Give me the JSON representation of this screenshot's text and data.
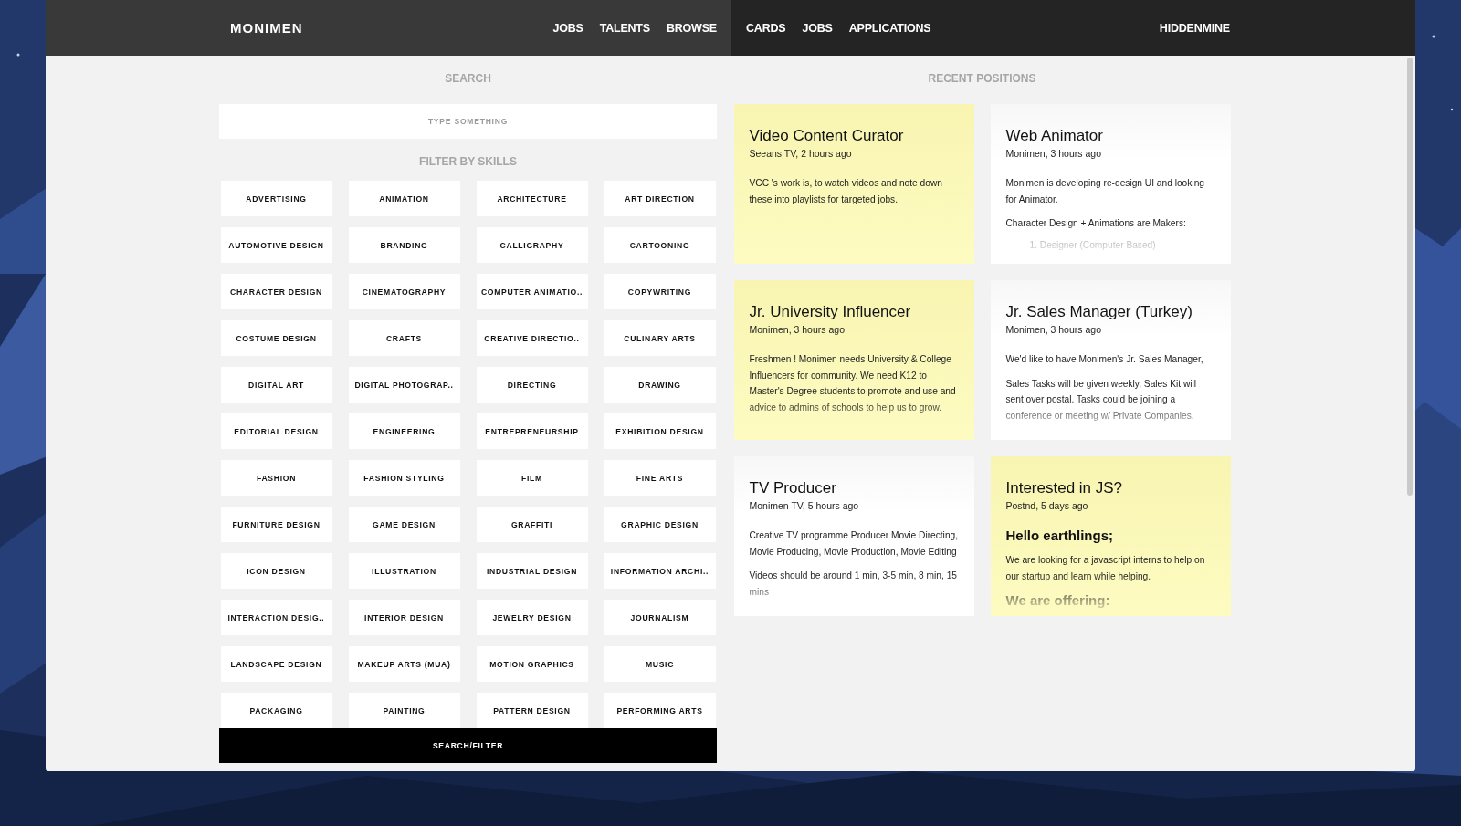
{
  "header": {
    "logo": "MONIMEN",
    "left_nav": [
      "JOBS",
      "TALENTS",
      "BROWSE"
    ],
    "right_nav": [
      "CARDS",
      "JOBS",
      "APPLICATIONS"
    ],
    "user": "HIDDENMINE"
  },
  "search": {
    "label": "SEARCH",
    "placeholder": "TYPE SOMETHING",
    "filter_label": "FILTER BY SKILLS",
    "button": "SEARCH/FILTER"
  },
  "skills": [
    {
      "label": "ADVERTISING",
      "selected": false
    },
    {
      "label": "ANIMATION",
      "selected": false
    },
    {
      "label": "ARCHITECTURE",
      "selected": false
    },
    {
      "label": "ART DIRECTION",
      "selected": false
    },
    {
      "label": "AUTOMOTIVE DESIGN",
      "selected": false
    },
    {
      "label": "BRANDING",
      "selected": false
    },
    {
      "label": "CALLIGRAPHY",
      "selected": false
    },
    {
      "label": "CARTOONING",
      "selected": false
    },
    {
      "label": "CHARACTER DESIGN",
      "selected": false
    },
    {
      "label": "CINEMATOGRAPHY",
      "selected": false
    },
    {
      "label": "COMPUTER ANIMATIO..",
      "selected": false
    },
    {
      "label": "COPYWRITING",
      "selected": false
    },
    {
      "label": "COSTUME DESIGN",
      "selected": false
    },
    {
      "label": "CRAFTS",
      "selected": false
    },
    {
      "label": "CREATIVE DIRECTIO..",
      "selected": false
    },
    {
      "label": "CULINARY ARTS",
      "selected": false
    },
    {
      "label": "DIGITAL ART",
      "selected": false
    },
    {
      "label": "DIGITAL PHOTOGRAP..",
      "selected": false
    },
    {
      "label": "DIRECTING",
      "selected": false
    },
    {
      "label": "DRAWING",
      "selected": false
    },
    {
      "label": "EDITORIAL DESIGN",
      "selected": false
    },
    {
      "label": "ENGINEERING",
      "selected": false
    },
    {
      "label": "ENTREPRENEURSHIP",
      "selected": false
    },
    {
      "label": "EXHIBITION DESIGN",
      "selected": false
    },
    {
      "label": "FASHION",
      "selected": false
    },
    {
      "label": "FASHION STYLING",
      "selected": false
    },
    {
      "label": "FILM",
      "selected": false
    },
    {
      "label": "FINE ARTS",
      "selected": false
    },
    {
      "label": "FURNITURE DESIGN",
      "selected": false
    },
    {
      "label": "GAME DESIGN",
      "selected": false
    },
    {
      "label": "GRAFFITI",
      "selected": false
    },
    {
      "label": "GRAPHIC DESIGN",
      "selected": false
    },
    {
      "label": "ICON DESIGN",
      "selected": false
    },
    {
      "label": "ILLUSTRATION",
      "selected": false
    },
    {
      "label": "INDUSTRIAL DESIGN",
      "selected": false
    },
    {
      "label": "INFORMATION ARCHI..",
      "selected": false
    },
    {
      "label": "INTERACTION DESIG..",
      "selected": false
    },
    {
      "label": "INTERIOR DESIGN",
      "selected": false
    },
    {
      "label": "JEWELRY DESIGN",
      "selected": false
    },
    {
      "label": "JOURNALISM",
      "selected": false
    },
    {
      "label": "LANDSCAPE DESIGN",
      "selected": false
    },
    {
      "label": "MAKEUP ARTS (MUA)",
      "selected": false
    },
    {
      "label": "MOTION GRAPHICS",
      "selected": false
    },
    {
      "label": "MUSIC",
      "selected": false
    },
    {
      "label": "PACKAGING",
      "selected": false
    },
    {
      "label": "PAINTING",
      "selected": false
    },
    {
      "label": "PATTERN DESIGN",
      "selected": false
    },
    {
      "label": "PERFORMING ARTS",
      "selected": false
    }
  ],
  "recent_positions": {
    "title": "RECENT POSITIONS",
    "positions": [
      {
        "title": "Video Content Curator",
        "meta": "Seeans TV, 2 hours ago",
        "highlighted": true,
        "body": [
          {
            "kind": "paragraph",
            "text": "VCC 's work is, to watch videos and note down these into playlists for targeted jobs."
          }
        ]
      },
      {
        "title": "Web Animator",
        "meta": "Monimen, 3 hours ago",
        "highlighted": false,
        "body": [
          {
            "kind": "paragraph",
            "text": "Monimen is developing re-design UI and looking for Animator."
          },
          {
            "kind": "paragraph",
            "text": "Character Design + Animations are Makers:"
          },
          {
            "kind": "list_item",
            "text": "1. Designer (Computer Based)"
          }
        ]
      },
      {
        "title": "Jr. University Influencer",
        "meta": "Monimen, 3 hours ago",
        "highlighted": true,
        "body": [
          {
            "kind": "paragraph",
            "text": "Freshmen ! Monimen needs University & College Influencers for community. We need K12 to Master's Degree students to promote and use and advice to admins of schools to help us to grow."
          }
        ]
      },
      {
        "title": "Jr. Sales Manager (Turkey)",
        "meta": "Monimen, 3 hours ago",
        "highlighted": false,
        "body": [
          {
            "kind": "paragraph",
            "text": "We'd like to have Monimen's Jr. Sales Manager,"
          },
          {
            "kind": "paragraph",
            "text": "Sales Tasks will be given weekly, Sales Kit will sent over postal. Tasks could be joining a conference or meeting w/ Private Companies."
          }
        ]
      },
      {
        "title": "TV Producer",
        "meta": "Monimen TV, 5 hours ago",
        "highlighted": false,
        "body": [
          {
            "kind": "paragraph",
            "text": "Creative TV programme Producer Movie Directing, Movie Producing, Movie Production, Movie Editing"
          },
          {
            "kind": "paragraph",
            "text": "Videos should be around 1 min, 3-5 min, 8 min, 15 mins"
          }
        ]
      },
      {
        "title": "Interested in JS?",
        "meta": "Postnd, 5 days ago",
        "highlighted": true,
        "body": [
          {
            "kind": "heading",
            "text": "Hello earthlings;"
          },
          {
            "kind": "paragraph",
            "text": "We are looking for a javascript interns to help on our startup and learn while helping."
          },
          {
            "kind": "heading",
            "text": "We are offering:"
          }
        ]
      }
    ]
  }
}
